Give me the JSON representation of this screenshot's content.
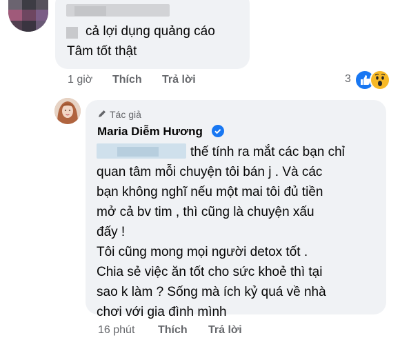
{
  "comment1": {
    "text_line1": "cả lợi dụng quảng cáo",
    "text_line2": "Tâm tốt thật",
    "time": "1 giờ",
    "like_label": "Thích",
    "reply_label": "Trả lời",
    "reaction_count": "3",
    "reactions": [
      "like-icon",
      "wow-icon"
    ]
  },
  "comment2": {
    "badge_label": "Tác giả",
    "author": "Maria Diễm Hương",
    "lines": [
      "thế tính ra mắt các bạn chỉ",
      "quan tâm mỗi chuyện tôi bán j . Và các",
      "bạn không nghĩ nếu một mai tôi đủ tiền",
      "mở cả bv tim , thì cũng là chuyện xấu",
      "đấy !",
      "Tôi cũng mong mọi người detox tốt .",
      "Chia sẻ việc ăn tốt cho sức khoẻ thì tại",
      "sao k làm ? Sống mà ích kỷ quá về nhà",
      "chơi với gia đình mình"
    ],
    "time": "16 phút",
    "like_label": "Thích",
    "reply_label": "Trả lời"
  },
  "colors": {
    "bubble": "#f0f2f5",
    "meta": "#65676b",
    "accent": "#1877f2"
  }
}
